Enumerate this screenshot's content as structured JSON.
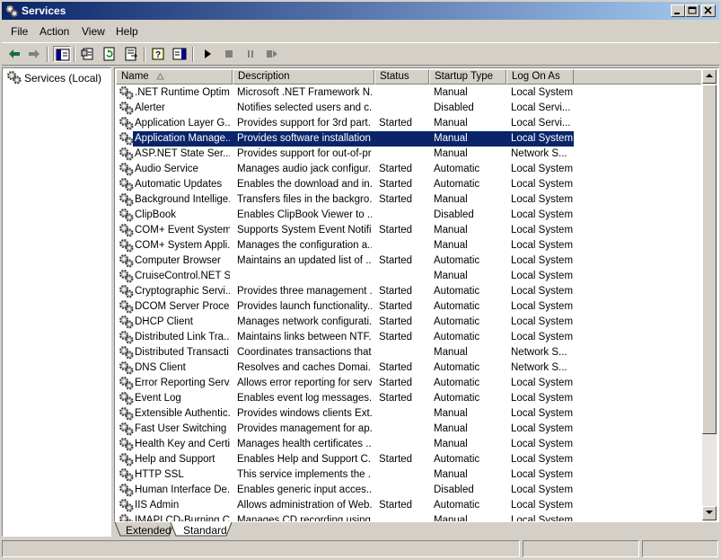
{
  "window": {
    "title": "Services"
  },
  "menu": [
    "File",
    "Action",
    "View",
    "Help"
  ],
  "toolbar": {
    "buttons": [
      "back-icon",
      "forward-icon",
      "show-hide-tree-icon",
      "properties-icon",
      "refresh-icon",
      "export-list-icon",
      "help-icon",
      "show-hide-action-pane-icon",
      "start-service-icon",
      "stop-service-icon",
      "pause-service-icon",
      "restart-service-icon"
    ]
  },
  "tree": {
    "root_label": "Services (Local)"
  },
  "columns": [
    "Name",
    "Description",
    "Status",
    "Startup Type",
    "Log On As"
  ],
  "services": [
    {
      "name": ".NET Runtime Optim...",
      "description": "Microsoft .NET Framework N...",
      "status": "",
      "startup": "Manual",
      "logon": "Local System"
    },
    {
      "name": "Alerter",
      "description": "Notifies selected users and c...",
      "status": "",
      "startup": "Disabled",
      "logon": "Local Servi..."
    },
    {
      "name": "Application Layer G...",
      "description": "Provides support for 3rd part...",
      "status": "Started",
      "startup": "Manual",
      "logon": "Local Servi..."
    },
    {
      "name": "Application Manage...",
      "description": "Provides software installation...",
      "status": "",
      "startup": "Manual",
      "logon": "Local System",
      "selected": true
    },
    {
      "name": "ASP.NET State Ser...",
      "description": "Provides support for out-of-pr...",
      "status": "",
      "startup": "Manual",
      "logon": "Network S..."
    },
    {
      "name": "Audio Service",
      "description": "Manages audio jack configur...",
      "status": "Started",
      "startup": "Automatic",
      "logon": "Local System"
    },
    {
      "name": "Automatic Updates",
      "description": "Enables the download and in...",
      "status": "Started",
      "startup": "Automatic",
      "logon": "Local System"
    },
    {
      "name": "Background Intellige...",
      "description": "Transfers files in the backgro...",
      "status": "Started",
      "startup": "Manual",
      "logon": "Local System"
    },
    {
      "name": "ClipBook",
      "description": "Enables ClipBook Viewer to ...",
      "status": "",
      "startup": "Disabled",
      "logon": "Local System"
    },
    {
      "name": "COM+ Event System",
      "description": "Supports System Event Notifi...",
      "status": "Started",
      "startup": "Manual",
      "logon": "Local System"
    },
    {
      "name": "COM+ System Appli...",
      "description": "Manages the configuration a...",
      "status": "",
      "startup": "Manual",
      "logon": "Local System"
    },
    {
      "name": "Computer Browser",
      "description": "Maintains an updated list of ...",
      "status": "Started",
      "startup": "Automatic",
      "logon": "Local System"
    },
    {
      "name": "CruiseControl.NET S...",
      "description": "",
      "status": "",
      "startup": "Manual",
      "logon": "Local System"
    },
    {
      "name": "Cryptographic Servi...",
      "description": "Provides three management ...",
      "status": "Started",
      "startup": "Automatic",
      "logon": "Local System"
    },
    {
      "name": "DCOM Server Proce...",
      "description": "Provides launch functionality...",
      "status": "Started",
      "startup": "Automatic",
      "logon": "Local System"
    },
    {
      "name": "DHCP Client",
      "description": "Manages network configurati...",
      "status": "Started",
      "startup": "Automatic",
      "logon": "Local System"
    },
    {
      "name": "Distributed Link Tra...",
      "description": "Maintains links between NTF...",
      "status": "Started",
      "startup": "Automatic",
      "logon": "Local System"
    },
    {
      "name": "Distributed Transacti...",
      "description": "Coordinates transactions that...",
      "status": "",
      "startup": "Manual",
      "logon": "Network S..."
    },
    {
      "name": "DNS Client",
      "description": "Resolves and caches Domai...",
      "status": "Started",
      "startup": "Automatic",
      "logon": "Network S..."
    },
    {
      "name": "Error Reporting Serv...",
      "description": "Allows error reporting for serv...",
      "status": "Started",
      "startup": "Automatic",
      "logon": "Local System"
    },
    {
      "name": "Event Log",
      "description": "Enables event log messages...",
      "status": "Started",
      "startup": "Automatic",
      "logon": "Local System"
    },
    {
      "name": "Extensible Authentic...",
      "description": "Provides windows clients Ext...",
      "status": "",
      "startup": "Manual",
      "logon": "Local System"
    },
    {
      "name": "Fast User Switching ...",
      "description": "Provides management for ap...",
      "status": "",
      "startup": "Manual",
      "logon": "Local System"
    },
    {
      "name": "Health Key and Certi...",
      "description": "Manages health certificates ...",
      "status": "",
      "startup": "Manual",
      "logon": "Local System"
    },
    {
      "name": "Help and Support",
      "description": "Enables Help and Support C...",
      "status": "Started",
      "startup": "Automatic",
      "logon": "Local System"
    },
    {
      "name": "HTTP SSL",
      "description": "This service implements the ...",
      "status": "",
      "startup": "Manual",
      "logon": "Local System"
    },
    {
      "name": "Human Interface De...",
      "description": "Enables generic input acces...",
      "status": "",
      "startup": "Disabled",
      "logon": "Local System"
    },
    {
      "name": "IIS Admin",
      "description": "Allows administration of Web...",
      "status": "Started",
      "startup": "Automatic",
      "logon": "Local System"
    },
    {
      "name": "IMAPI CD-Burning C...",
      "description": "Manages CD recording using...",
      "status": "",
      "startup": "Manual",
      "logon": "Local System"
    }
  ],
  "tabs": [
    "Extended",
    "Standard"
  ],
  "active_tab": "Standard",
  "colors": {
    "selection": "#0a246a",
    "titlebar_start": "#0a246a",
    "titlebar_end": "#a6caf0",
    "face": "#d4d0c8"
  }
}
